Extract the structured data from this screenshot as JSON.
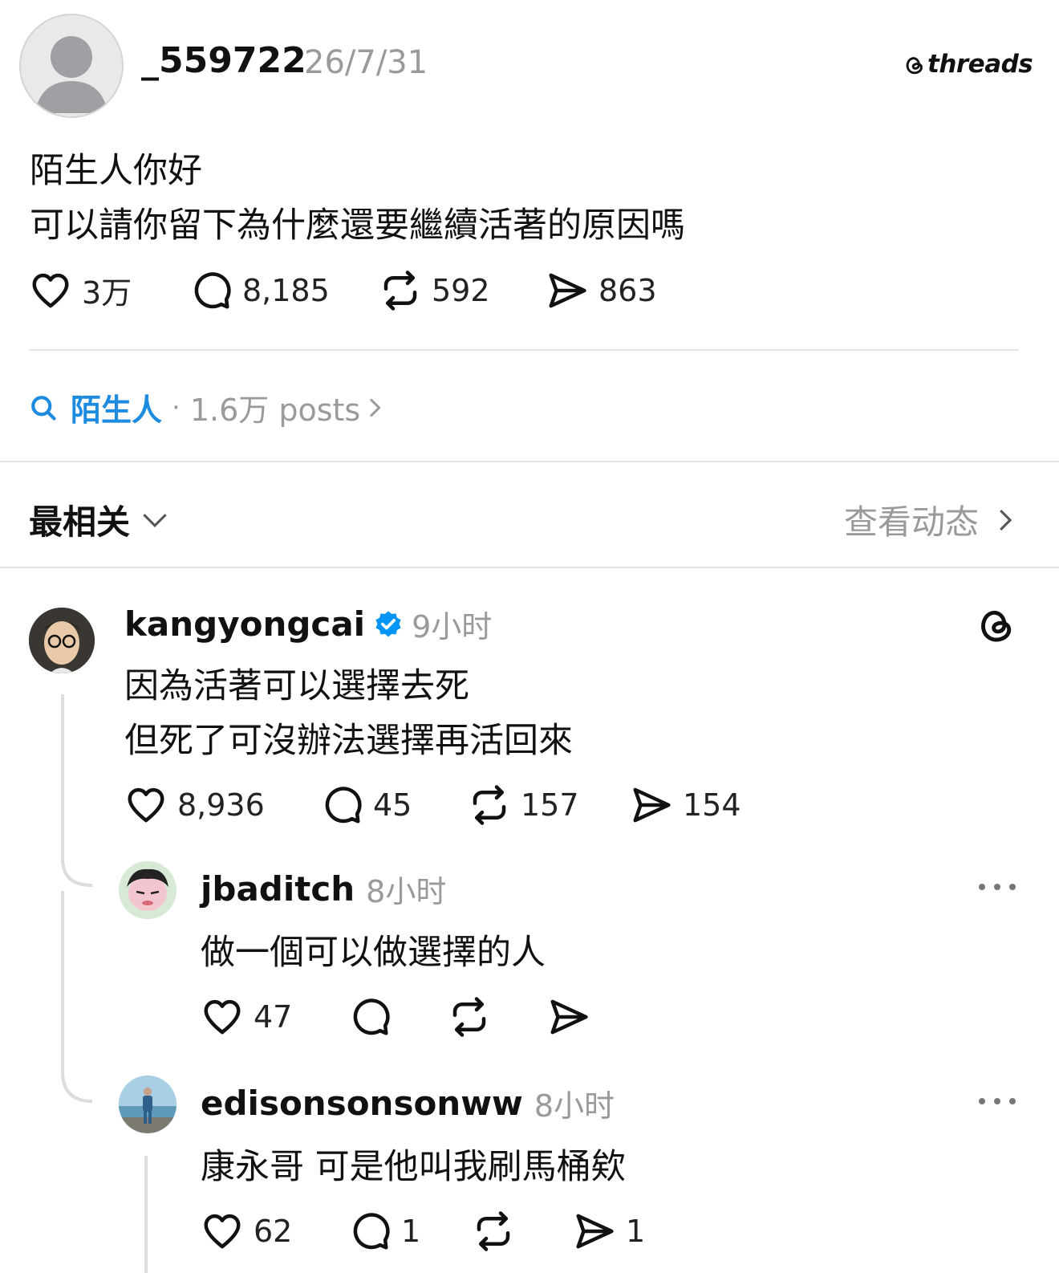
{
  "post": {
    "username": "_559722",
    "date": "26/7/31",
    "brand": "threads",
    "line1": "陌生人你好",
    "line2": "可以請你留下為什麼還要繼續活著的原因嗎",
    "likes": "3万",
    "comments": "8,185",
    "reposts": "592",
    "shares": "863"
  },
  "topic": {
    "name": "陌生人",
    "dot": "·",
    "count": "1.6万 posts"
  },
  "sort": {
    "label": "最相关",
    "activity": "查看动态"
  },
  "replies": [
    {
      "username": "kangyongcai",
      "time": "9小时",
      "verified": true,
      "line1": "因為活著可以選擇去死",
      "line2": "但死了可沒辦法選擇再活回來",
      "likes": "8,936",
      "comments": "45",
      "reposts": "157",
      "shares": "154"
    },
    {
      "username": "jbaditch",
      "time": "8小时",
      "text": "做一個可以做選擇的人",
      "likes": "47"
    },
    {
      "username": "edisonsonsonww",
      "time": "8小时",
      "text": "康永哥 可是他叫我刷馬桶欸",
      "likes": "62",
      "comments": "1",
      "shares": "1"
    }
  ],
  "colors": {
    "accent": "#1d8ce0",
    "verified": "#0095f6",
    "divider": "#e4e4e4",
    "muted": "#9a9a9a"
  }
}
